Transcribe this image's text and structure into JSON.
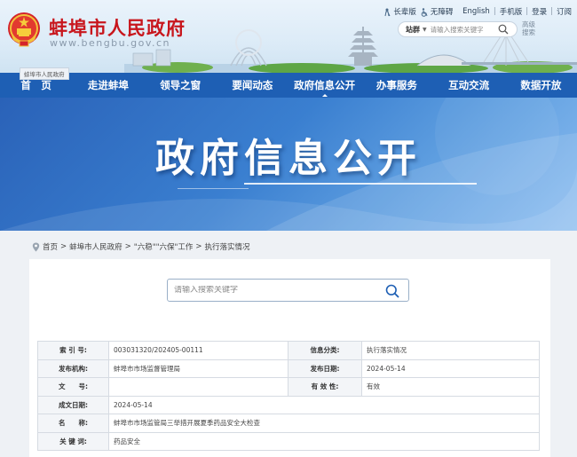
{
  "header": {
    "site_title": "蚌埠市人民政府",
    "site_domain": "www.bengbu.gov.cn",
    "top_links": {
      "elder": "长辈版",
      "accessible": "无障碍",
      "english": "English",
      "mobile": "手机版",
      "login": "登录",
      "subscribe": "订阅"
    },
    "search": {
      "scope": "站群",
      "placeholder": "请输入搜索关键字"
    },
    "advanced_search": "高级搜索",
    "nav_tag": "蚌埠市人民政府"
  },
  "nav": {
    "items": [
      {
        "label": "首　页"
      },
      {
        "label": "走进蚌埠"
      },
      {
        "label": "领导之窗"
      },
      {
        "label": "要闻动态"
      },
      {
        "label": "政府信息公开"
      },
      {
        "label": "办事服务"
      },
      {
        "label": "互动交流"
      },
      {
        "label": "数据开放"
      }
    ]
  },
  "banner": {
    "title": "政府信息公开"
  },
  "breadcrumb": {
    "home": "首页",
    "gov": "蚌埠市人民政府",
    "section": "\"六稳\"\"六保\"工作",
    "current": "执行落实情况"
  },
  "content_search": {
    "placeholder": "请输入搜索关键字"
  },
  "info_table": {
    "index_label": "索 引 号:",
    "index_value": "003031320/202405-00111",
    "category_label": "信息分类:",
    "category_value": "执行落实情况",
    "publisher_label": "发布机构:",
    "publisher_value": "蚌埠市市场监督管理局",
    "pub_date_label": "发布日期:",
    "pub_date_value": "2024-05-14",
    "doc_no_label": "文　　号:",
    "doc_no_value": "",
    "validity_label": "有 效 性:",
    "validity_value": "有效",
    "created_label": "成文日期:",
    "created_value": "2024-05-14",
    "name_label": "名　　称:",
    "name_value": "蚌埠市市场监管局三举措开展夏季药品安全大检查",
    "keywords_label": "关 键 词:",
    "keywords_value": "药品安全"
  },
  "colors": {
    "brand_red": "#c8161d",
    "nav_blue": "#1e5fb4"
  }
}
